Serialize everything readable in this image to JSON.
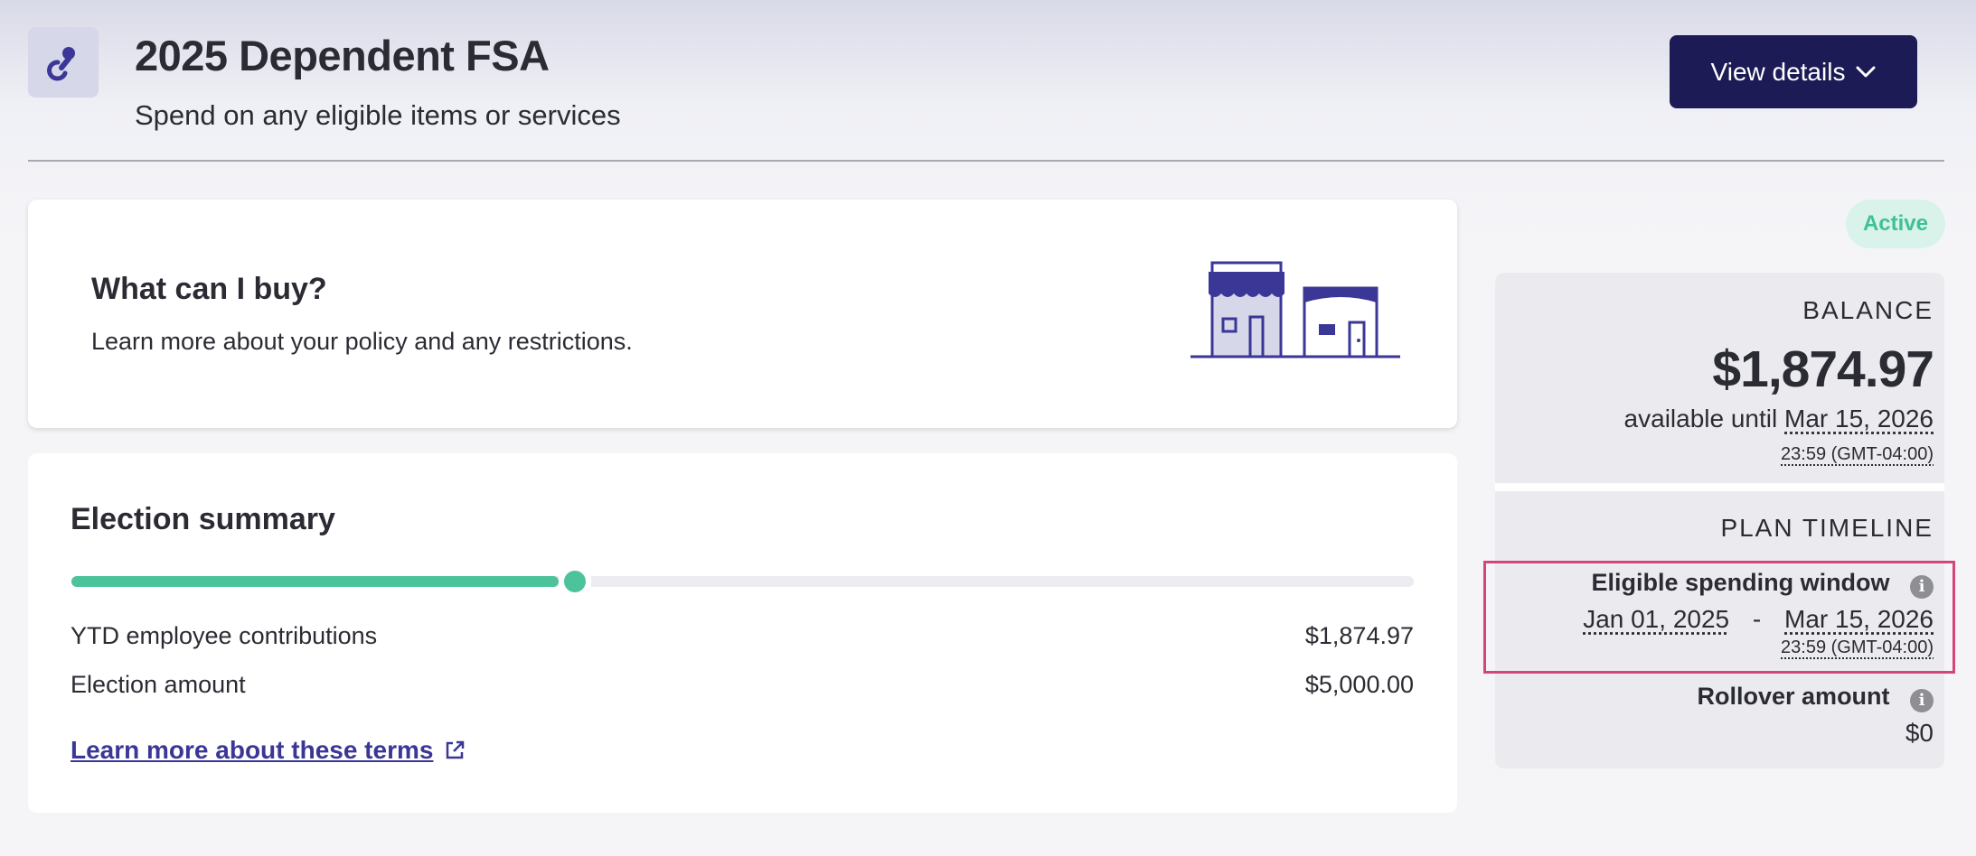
{
  "header": {
    "title": "2025 Dependent FSA",
    "subtitle": "Spend on any eligible items or services",
    "plan_icon": "pacifier-icon",
    "view_details_label": "View details",
    "view_details_icon": "chevron-down-icon"
  },
  "buy_card": {
    "title": "What can I buy?",
    "description": "Learn more about your policy and any restrictions.",
    "illustration": "storefronts-illustration"
  },
  "election": {
    "title": "Election summary",
    "progress_fraction": 0.375,
    "rows": [
      {
        "label": "YTD employee contributions",
        "value": "$1,874.97"
      },
      {
        "label": "Election amount",
        "value": "$5,000.00"
      }
    ],
    "link_label": "Learn more about these terms",
    "link_icon": "external-link-icon"
  },
  "status": "Active",
  "balance": {
    "heading": "BALANCE",
    "amount": "$1,874.97",
    "available_prefix": "available until",
    "available_date": "Mar 15, 2026",
    "available_time": "23:59 (GMT-04:00)"
  },
  "timeline": {
    "heading": "PLAN TIMELINE",
    "window_label": "Eligible spending window",
    "window_start": "Jan 01, 2025",
    "window_separator": "-",
    "window_end": "Mar 15, 2026",
    "window_time": "23:59 (GMT-04:00)",
    "rollover_label": "Rollover amount",
    "rollover_value": "$0",
    "info_icon": "info-icon"
  },
  "colors": {
    "primary": "#1c1b55",
    "accent_green": "#4cc39a",
    "link": "#3a3796",
    "highlight": "#d4457a"
  }
}
